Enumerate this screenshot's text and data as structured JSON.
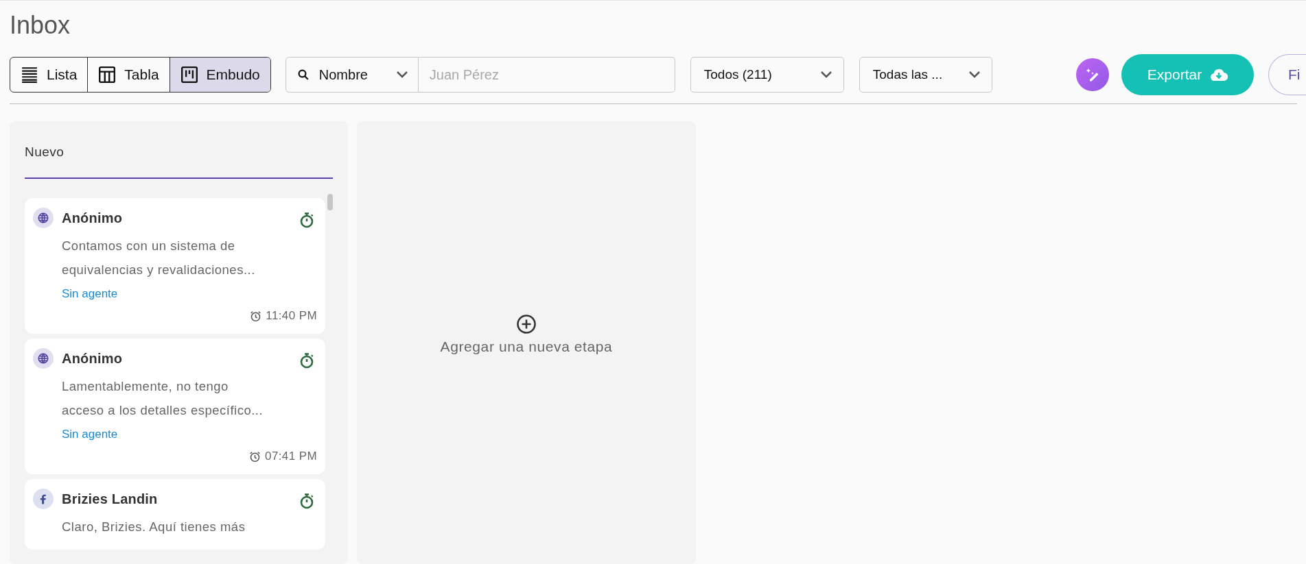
{
  "page": {
    "title": "Inbox"
  },
  "view_switch": [
    {
      "kind": "list",
      "label": "Lista",
      "selected": false
    },
    {
      "kind": "table",
      "label": "Tabla",
      "selected": false
    },
    {
      "kind": "kanban",
      "label": "Embudo",
      "selected": true
    }
  ],
  "search": {
    "field": "Nombre",
    "placeholder": "Juan Pérez"
  },
  "filters": [
    {
      "label": "Todos (211)"
    },
    {
      "label": "Todas las ..."
    }
  ],
  "actions": {
    "export": "Exportar",
    "filter_button": "Fi"
  },
  "stages": [
    {
      "title": "Nuevo",
      "cards": [
        {
          "kind": "web",
          "name": "Anónimo",
          "preview": "Contamos con un sistema de\nequivalencias y revalidaciones...",
          "agent": "Sin agente",
          "time": "11:40 PM"
        },
        {
          "kind": "web",
          "name": "Anónimo",
          "preview": "Lamentablemente, no tengo\nacceso a los detalles específico...",
          "agent": "Sin agente",
          "time": "07:41 PM"
        },
        {
          "kind": "facebook",
          "name": "Brizies Landin",
          "preview": "Claro, Brizies. Aquí tienes más"
        }
      ]
    }
  ],
  "add_stage": {
    "label": "Agregar una nueva etapa"
  }
}
